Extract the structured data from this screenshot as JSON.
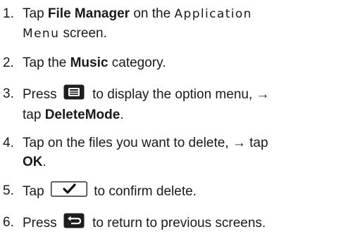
{
  "steps": [
    {
      "number": "1.",
      "before": "Tap ",
      "bold": "File Manager",
      "after": " on the ",
      "app_word": "Application",
      "menu_word": "Menu",
      "tail": " screen."
    },
    {
      "number": "2.",
      "before": "Tap the ",
      "bold": "Music",
      "after": " category."
    },
    {
      "number": "3.",
      "before": "Press ",
      "icon": "menu-key-icon",
      "after": " to display the option menu, →",
      "line2_before": "tap ",
      "bold": "DeleteMode",
      "line2_after": "."
    },
    {
      "number": "4.",
      "before": "Tap on the files you want to delete, → tap",
      "bold": "OK",
      "after": "."
    },
    {
      "number": "5.",
      "before": "Tap ",
      "icon": "checkmark-button-icon",
      "after": " to confirm delete."
    },
    {
      "number": "6.",
      "before": "Press ",
      "icon": "back-key-icon",
      "after": " to return to previous screens."
    }
  ]
}
